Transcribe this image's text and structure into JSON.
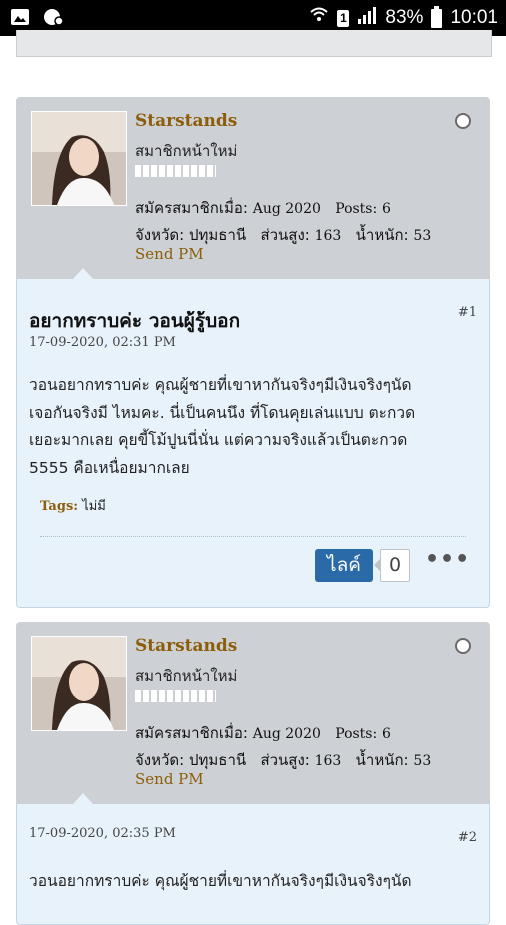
{
  "status_bar": {
    "battery": "83%",
    "time": "10:01",
    "sim": "1"
  },
  "posts": [
    {
      "user": {
        "name": "Starstands",
        "rank": "สมาชิกหน้าใหม่",
        "joined_label": "สมัครสมาชิกเมื่อ:",
        "joined_value": "Aug 2020",
        "posts_label": "Posts:",
        "posts_value": "6",
        "province_label": "จังหวัด:",
        "province_value": "ปทุมธานี",
        "height_label": "ส่วนสูง:",
        "height_value": "163",
        "weight_label": "น้ำหนัก:",
        "weight_value": "53",
        "send_pm": "Send PM"
      },
      "title": "อยากทราบค่ะ วอนผู้รู้บอก",
      "number": "#1",
      "date": "17-09-2020, 02:31 PM",
      "body_lines": [
        "วอนอยากทราบค่ะ คุณผู้ชายที่เขาหากันจริงๆมีเงินจริงๆนัด",
        "เจอกันจริงมี ไหมคะ. นี่เป็นคนนึง ที่โดนคุยเล่นแบบ ตะกวด",
        "เยอะมากเลย คุยขี้โม้ปูนนี่นั่น แต่ความจริงแล้วเป็นตะกวด",
        "5555 คือเหนื่อยมากเลย"
      ],
      "tags_label": "Tags:",
      "tags_value": "ไม่มี",
      "like_label": "ไลค์",
      "like_count": "0"
    },
    {
      "user": {
        "name": "Starstands",
        "rank": "สมาชิกหน้าใหม่",
        "joined_label": "สมัครสมาชิกเมื่อ:",
        "joined_value": "Aug 2020",
        "posts_label": "Posts:",
        "posts_value": "6",
        "province_label": "จังหวัด:",
        "province_value": "ปทุมธานี",
        "height_label": "ส่วนสูง:",
        "height_value": "163",
        "weight_label": "น้ำหนัก:",
        "weight_value": "53",
        "send_pm": "Send PM"
      },
      "number": "#2",
      "date": "17-09-2020, 02:35 PM",
      "body_lines": [
        "วอนอยากทราบค่ะ คุณผู้ชายที่เขาหากันจริงๆมีเงินจริงๆนัด"
      ]
    }
  ]
}
